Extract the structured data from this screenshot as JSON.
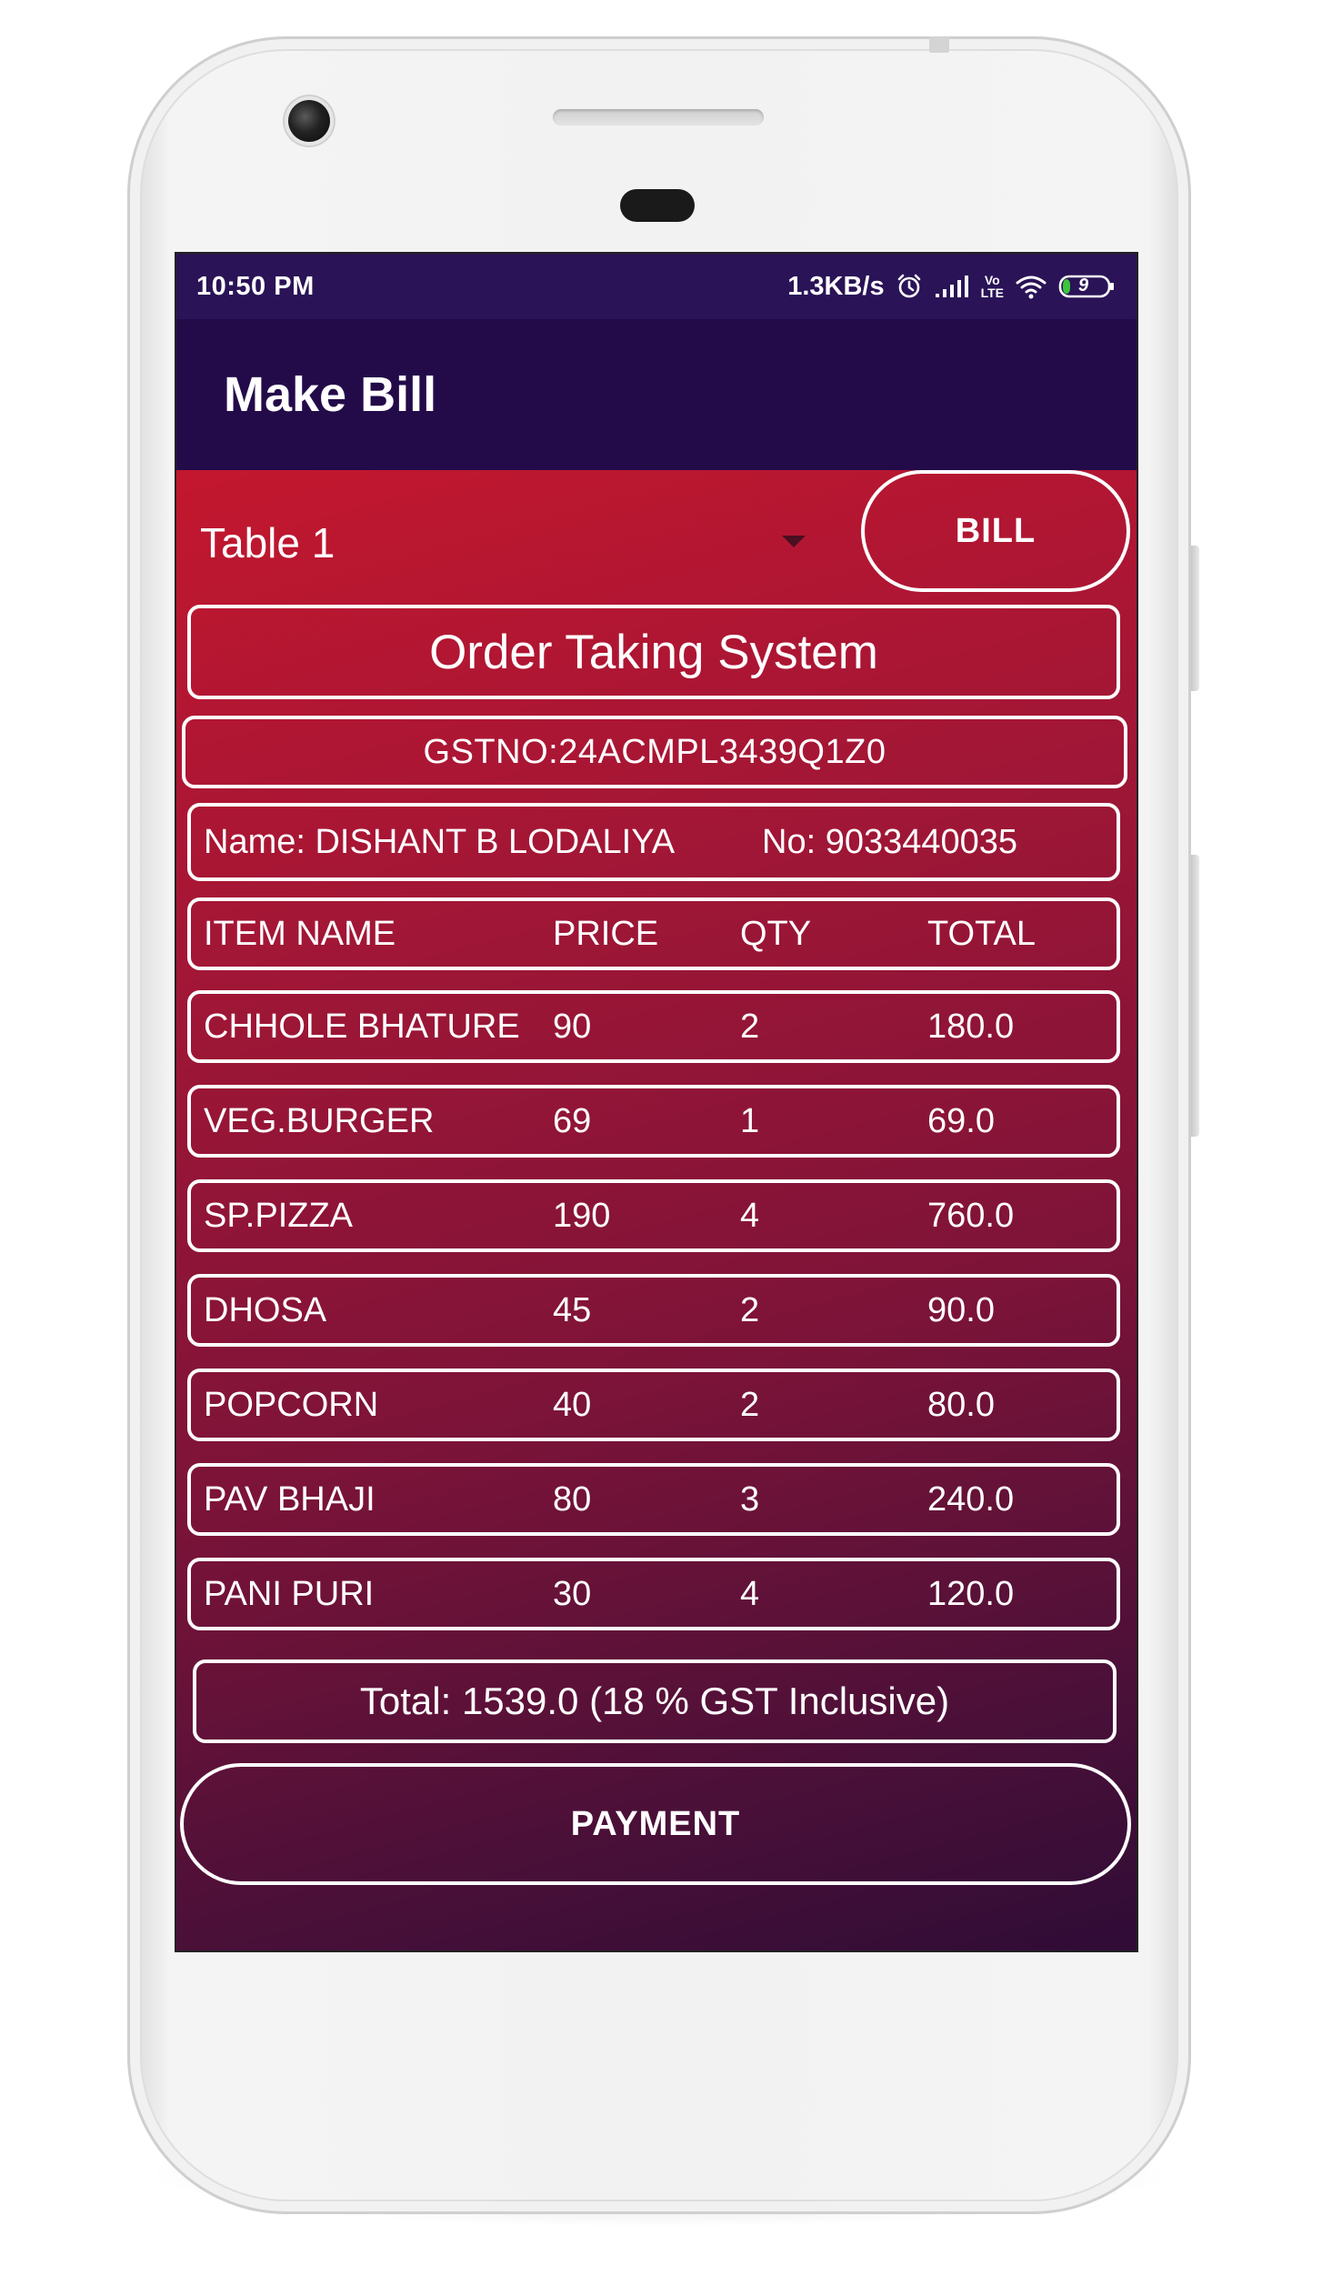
{
  "status_bar": {
    "time": "10:50 PM",
    "net_speed": "1.3KB/s",
    "volte_label_top": "Vo",
    "volte_label_bottom": "LTE",
    "battery_level": "9",
    "icons": [
      "alarm-icon",
      "signal-icon",
      "volte-icon",
      "wifi-icon",
      "battery-icon"
    ]
  },
  "app_bar": {
    "title": "Make Bill"
  },
  "table_picker": {
    "selected": "Table 1"
  },
  "bill_button": {
    "label": "BILL"
  },
  "header": {
    "system_title": "Order Taking System",
    "gst_number": "GSTNO:24ACMPL3439Q1Z0",
    "customer_name": "Name: DISHANT B LODALIYA",
    "customer_phone": "No: 9033440035"
  },
  "table": {
    "columns": [
      "ITEM NAME",
      "PRICE",
      "QTY",
      "TOTAL"
    ],
    "rows": [
      [
        "CHHOLE BHATURE",
        "90",
        "2",
        "180.0"
      ],
      [
        "VEG.BURGER",
        "69",
        "1",
        "69.0"
      ],
      [
        "SP.PIZZA",
        "190",
        "4",
        "760.0"
      ],
      [
        "DHOSA",
        "45",
        "2",
        "90.0"
      ],
      [
        "POPCORN",
        "40",
        "2",
        "80.0"
      ],
      [
        "PAV BHAJI",
        "80",
        "3",
        "240.0"
      ],
      [
        "PANI PURI",
        "30",
        "4",
        "120.0"
      ]
    ]
  },
  "summary": {
    "total_text": "Total: 1539.0 (18 % GST Inclusive)"
  },
  "payment_button": {
    "label": "PAYMENT"
  },
  "colors": {
    "status_bar": "#2a1356",
    "app_bar": "#230b49",
    "gradient_top": "#c3172e",
    "gradient_bottom": "#2f0c36",
    "border": "#ffffff"
  }
}
